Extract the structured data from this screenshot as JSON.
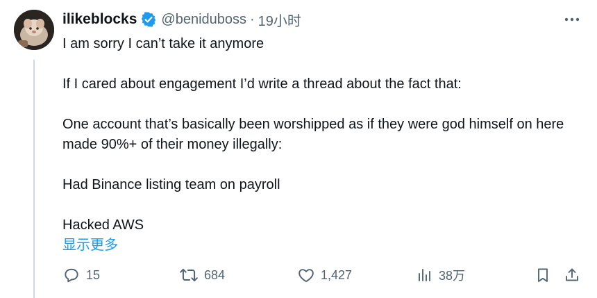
{
  "tweet": {
    "author": {
      "display_name": "ilikeblocks",
      "handle": "@beniduboss",
      "verified": true,
      "avatar_icon": "avatar-image"
    },
    "separator": "·",
    "timestamp": "19小时",
    "more_icon": "more-horizontal-icon",
    "text": {
      "line1": "I am sorry I can’t take it anymore",
      "line2": "If I cared about engagement I’d write a thread about the fact that:",
      "line3": "One account that’s basically been worshipped as if they were god himself on here made 90%+ of their money illegally:",
      "line4": "Had Binance listing team on payroll",
      "line5": "Hacked AWS"
    },
    "show_more_label": "显示更多",
    "actions": {
      "replies": "15",
      "reposts": "684",
      "likes": "1,427",
      "views": "38万"
    },
    "colors": {
      "text": "#0f1419",
      "secondary": "#536471",
      "link": "#1d9bf0",
      "verified": "#1d9bf0",
      "thread_line": "#cfd9de"
    }
  }
}
